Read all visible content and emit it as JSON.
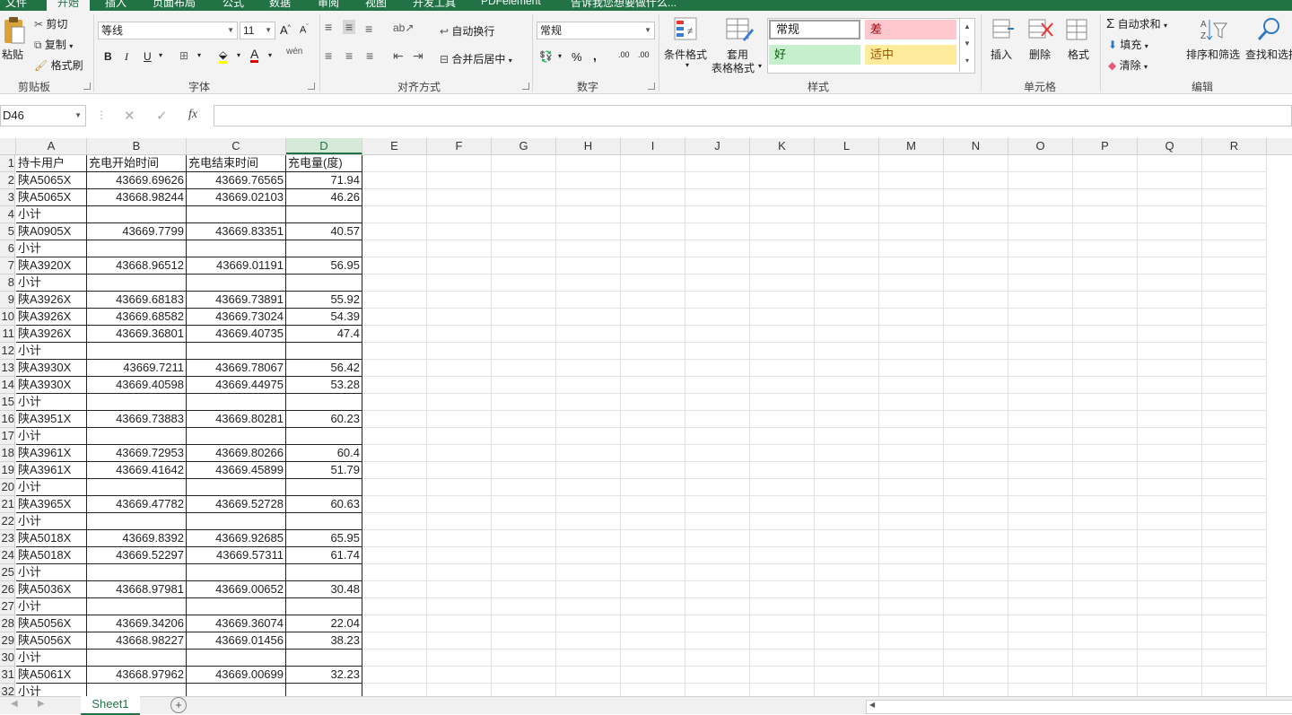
{
  "ribbon_tabs": [
    "文件",
    "开始",
    "插入",
    "页面布局",
    "公式",
    "数据",
    "审阅",
    "视图",
    "开发工具",
    "PDFelement",
    "告诉我您想要做什么..."
  ],
  "ribbon": {
    "clipboard": {
      "paste": "粘贴",
      "cut": "剪切",
      "copy": "复制",
      "format_painter": "格式刷",
      "label": "剪贴板"
    },
    "font": {
      "font_name": "等线",
      "font_size": "11",
      "label": "字体"
    },
    "alignment": {
      "wrap": "自动换行",
      "merge": "合并后居中",
      "label": "对齐方式"
    },
    "number": {
      "format": "常规",
      "label": "数字"
    },
    "styles": {
      "conditional": "条件格式",
      "table_fmt_1": "套用",
      "table_fmt_2": "表格格式",
      "normal": "常规",
      "bad": "差",
      "good": "好",
      "neutral": "适中",
      "label": "样式"
    },
    "cells": {
      "insert": "插入",
      "delete": "删除",
      "format": "格式",
      "label": "单元格"
    },
    "editing": {
      "autosum": "自动求和",
      "fill": "填充",
      "clear": "清除",
      "sort": "排序和筛选",
      "find": "查找和选择",
      "label": "编辑"
    },
    "colors": {
      "bad_bg": "#ffc7ce",
      "bad_fg": "#9c0006",
      "good_bg": "#c6efce",
      "good_fg": "#006100",
      "neutral_bg": "#ffeb9c",
      "neutral_fg": "#9c5700"
    }
  },
  "formula_bar": {
    "name_box": "D46",
    "formula": ""
  },
  "columns": [
    "A",
    "B",
    "C",
    "D",
    "E",
    "F",
    "G",
    "H",
    "I",
    "J",
    "K",
    "L",
    "M",
    "N",
    "O",
    "P",
    "Q",
    "R"
  ],
  "selected_column": "D",
  "rows": [
    [
      "1",
      "持卡用户",
      "充电开始时间",
      "充电结束时间",
      "充电量(度)"
    ],
    [
      "2",
      "陕A5065X",
      "43669.69626",
      "43669.76565",
      "71.94"
    ],
    [
      "3",
      "陕A5065X",
      "43668.98244",
      "43669.02103",
      "46.26"
    ],
    [
      "4",
      "小计",
      "",
      "",
      ""
    ],
    [
      "5",
      "陕A0905X",
      "43669.7799",
      "43669.83351",
      "40.57"
    ],
    [
      "6",
      "小计",
      "",
      "",
      ""
    ],
    [
      "7",
      "陕A3920X",
      "43668.96512",
      "43669.01191",
      "56.95"
    ],
    [
      "8",
      "小计",
      "",
      "",
      ""
    ],
    [
      "9",
      "陕A3926X",
      "43669.68183",
      "43669.73891",
      "55.92"
    ],
    [
      "10",
      "陕A3926X",
      "43669.68582",
      "43669.73024",
      "54.39"
    ],
    [
      "11",
      "陕A3926X",
      "43669.36801",
      "43669.40735",
      "47.4"
    ],
    [
      "12",
      "小计",
      "",
      "",
      ""
    ],
    [
      "13",
      "陕A3930X",
      "43669.7211",
      "43669.78067",
      "56.42"
    ],
    [
      "14",
      "陕A3930X",
      "43669.40598",
      "43669.44975",
      "53.28"
    ],
    [
      "15",
      "小计",
      "",
      "",
      ""
    ],
    [
      "16",
      "陕A3951X",
      "43669.73883",
      "43669.80281",
      "60.23"
    ],
    [
      "17",
      "小计",
      "",
      "",
      ""
    ],
    [
      "18",
      "陕A3961X",
      "43669.72953",
      "43669.80266",
      "60.4"
    ],
    [
      "19",
      "陕A3961X",
      "43669.41642",
      "43669.45899",
      "51.79"
    ],
    [
      "20",
      "小计",
      "",
      "",
      ""
    ],
    [
      "21",
      "陕A3965X",
      "43669.47782",
      "43669.52728",
      "60.63"
    ],
    [
      "22",
      "小计",
      "",
      "",
      ""
    ],
    [
      "23",
      "陕A5018X",
      "43669.8392",
      "43669.92685",
      "65.95"
    ],
    [
      "24",
      "陕A5018X",
      "43669.52297",
      "43669.57311",
      "61.74"
    ],
    [
      "25",
      "小计",
      "",
      "",
      ""
    ],
    [
      "26",
      "陕A5036X",
      "43668.97981",
      "43669.00652",
      "30.48"
    ],
    [
      "27",
      "小计",
      "",
      "",
      ""
    ],
    [
      "28",
      "陕A5056X",
      "43669.34206",
      "43669.36074",
      "22.04"
    ],
    [
      "29",
      "陕A5056X",
      "43668.98227",
      "43669.01456",
      "38.23"
    ],
    [
      "30",
      "小计",
      "",
      "",
      ""
    ],
    [
      "31",
      "陕A5061X",
      "43668.97962",
      "43669.00699",
      "32.23"
    ],
    [
      "32",
      "小计",
      "",
      "",
      ""
    ]
  ],
  "sheets": [
    "Sheet1"
  ]
}
